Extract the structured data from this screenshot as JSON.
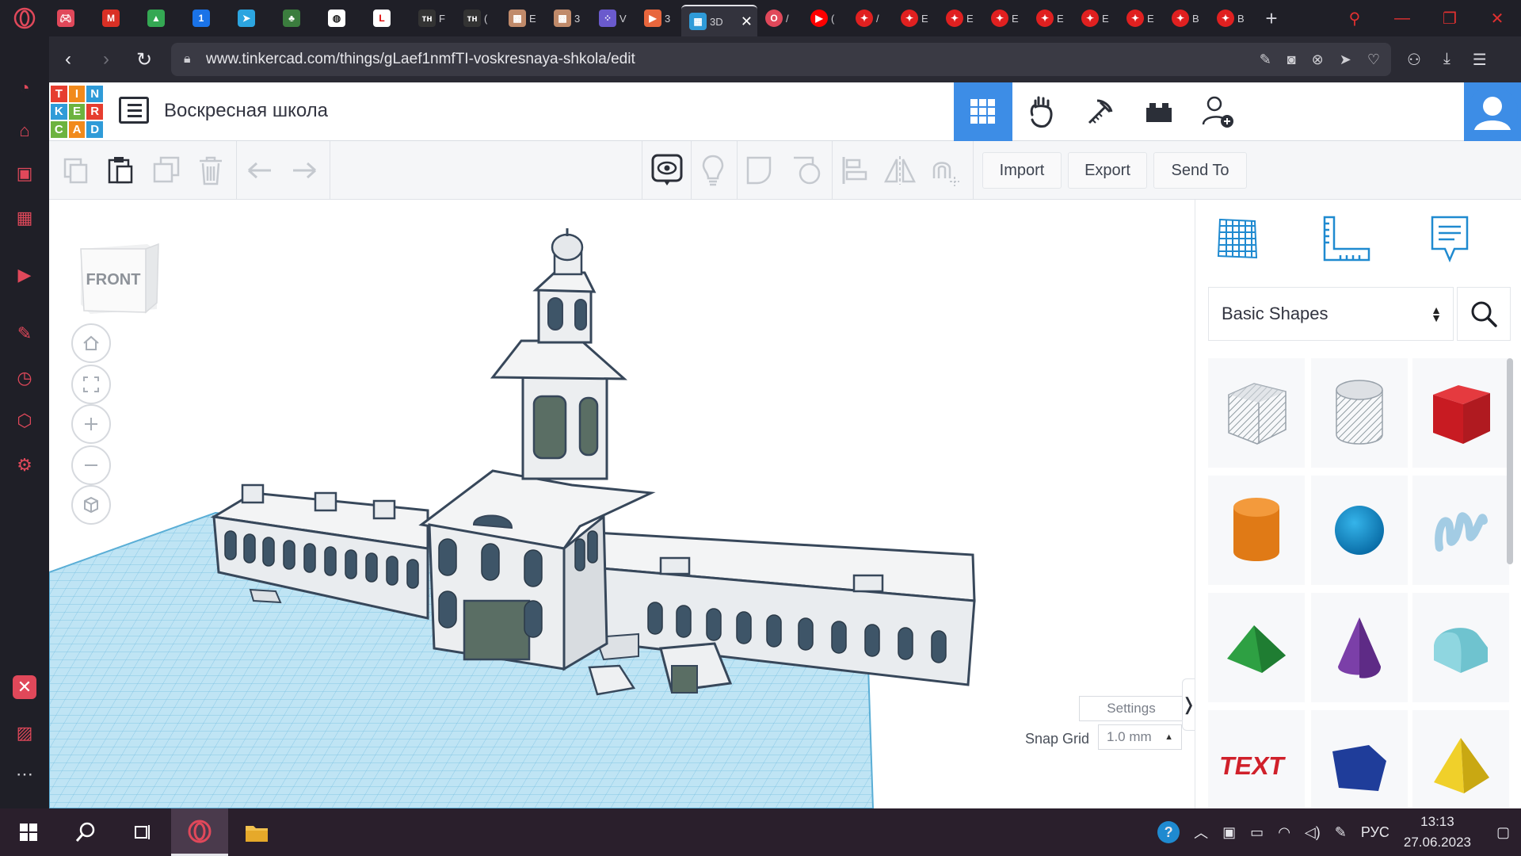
{
  "browser": {
    "tabs": [
      {
        "icon": "gamepad-icon",
        "label": ""
      },
      {
        "icon": "gmail-icon",
        "label": ""
      },
      {
        "icon": "google-drive-icon",
        "label": ""
      },
      {
        "icon": "onepassword-icon",
        "label": ""
      },
      {
        "icon": "telegram-icon",
        "label": ""
      },
      {
        "icon": "game-icon",
        "label": ""
      },
      {
        "icon": "globe-icon",
        "label": ""
      },
      {
        "icon": "l-icon",
        "label": ""
      },
      {
        "icon": "tn-icon",
        "label": "F"
      },
      {
        "icon": "tn-icon",
        "label": "("
      },
      {
        "icon": "image-icon",
        "label": "E"
      },
      {
        "icon": "image-icon",
        "label": "3"
      },
      {
        "icon": "dots-icon",
        "label": "V"
      },
      {
        "icon": "play-icon",
        "label": "3"
      },
      {
        "icon": "tinkercad-icon",
        "label": "3D",
        "active": true
      },
      {
        "icon": "opera-icon",
        "label": "/"
      },
      {
        "icon": "youtube-icon",
        "label": "("
      },
      {
        "icon": "star-red-icon",
        "label": "/"
      },
      {
        "icon": "star-red-icon",
        "label": "E"
      },
      {
        "icon": "star-red-icon",
        "label": "E"
      },
      {
        "icon": "star-red-icon",
        "label": "E"
      },
      {
        "icon": "star-red-icon",
        "label": "E"
      },
      {
        "icon": "star-red-icon",
        "label": "E"
      },
      {
        "icon": "star-red-icon",
        "label": "E"
      },
      {
        "icon": "star-red-icon",
        "label": "B"
      },
      {
        "icon": "star-red-icon",
        "label": "B"
      }
    ],
    "url": "www.tinkercad.com/things/gLaef1nmfTI-voskresnaya-shkola/edit"
  },
  "tinkercad": {
    "logo_letters": [
      "T",
      "I",
      "N",
      "K",
      "E",
      "R",
      "C",
      "A",
      "D"
    ],
    "design_title": "Воскресная школа",
    "toolbar": {
      "import_label": "Import",
      "export_label": "Export",
      "send_to_label": "Send To"
    },
    "viewcube_label": "FRONT",
    "workplane_settings_label": "Settings",
    "snap_grid_label": "Snap Grid",
    "snap_grid_value": "1.0 mm",
    "shape_category": "Basic Shapes"
  },
  "shapes": [
    {
      "name": "box-hole",
      "color": "#b9bec6"
    },
    {
      "name": "cylinder-hole",
      "color": "#c4c8cf"
    },
    {
      "name": "box",
      "color": "#d0202a"
    },
    {
      "name": "cylinder",
      "color": "#e07a16"
    },
    {
      "name": "sphere",
      "color": "#1a9bd6"
    },
    {
      "name": "scribble",
      "color": "#a9cfe6"
    },
    {
      "name": "roof",
      "color": "#2ea043"
    },
    {
      "name": "cone",
      "color": "#7b3fa8"
    },
    {
      "name": "round-roof",
      "color": "#6fc3cf"
    },
    {
      "name": "text",
      "color": "#d0202a"
    },
    {
      "name": "polygon",
      "color": "#1f3d9a"
    },
    {
      "name": "pyramid",
      "color": "#e7c51a"
    }
  ],
  "taskbar": {
    "lang": "РУС",
    "time": "13:13",
    "date": "27.06.2023"
  }
}
